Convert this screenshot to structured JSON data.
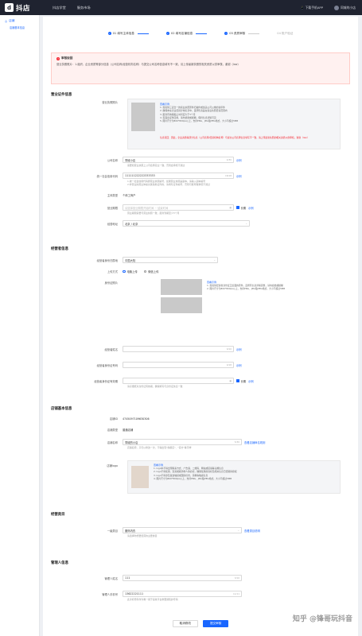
{
  "topbar": {
    "app_name": "抖店",
    "logo_glyph": "d",
    "nav": [
      "抖店学堂",
      "服务市场"
    ],
    "download": "下载手机APP",
    "user": "同城的小店"
  },
  "sidebar": {
    "section": "店铺",
    "item": "店铺基本信息"
  },
  "steps": [
    {
      "label": "01 填写主体信息",
      "state": "done"
    },
    {
      "label": "02 填写店铺信息",
      "state": "done"
    },
    {
      "label": "03 资质审核",
      "state": "current"
    },
    {
      "label": "04 账户验证",
      "state": "todo"
    }
  ],
  "alert": {
    "title": "审核驳回",
    "body": "营业执照照片：1.组织、企业资质等部分信息（公司名称/经营机构名称）与提交公司名称信息填写不一致，请上传最新执照的相关资质以供审核，谢谢（law）"
  },
  "license": {
    "title": "营业证件信息",
    "photo_label": "营业执照照片",
    "tips_title": "查看示例",
    "tips": [
      "1. 需提供三证合一的营业执照原件扫描件或加盖公司公章的复印件",
      "2. 确保未在企业经营异常名录中，且所售商品在营业执照经营范围内",
      "3. 距离有效期截止时间应大于3个月",
      "4. 需露出证件四角，请勿遮挡或模糊，保持信息清晰可见",
      "5. 图片尺寸为800*800px以上，支持PNG、JPG和JPEG格式，大小不超过5MB"
    ],
    "warning": "信息驳回：因此，企业资质等部分信息（公司名称/经营机构名称）与提交公司名称信息填写不一致，请上传最新执照的相关资质以供审核，谢谢（law）",
    "company_label": "公司名称",
    "company_value": "同城小店",
    "company_counter": "4/30",
    "company_link": "示例",
    "company_hint": "需要和营业执照上公司名称完全一致，否则会审核不通过",
    "credit_label": "统一社会信用代码",
    "credit_value": "111111222222333333",
    "credit_counter": "18/18",
    "credit_link": "示例",
    "credit_hint": "1.统一社会信用代码即营业执照编号，如果营业执照是副本，请输入副本编号\n2.非营业执照主体提交其他类证件的，请填写证件编号，否则可能导致审核不通过",
    "entity_label": "主体类型",
    "entity_value": "个体工商户",
    "period_label": "营业期限",
    "period_placeholder": "请选择营业期限开始时间 ~ 结束时间",
    "period_check": "长期",
    "period_link": "示例",
    "period_hint": "营业期限需要与营业执照一致，距离到期至少3个月",
    "address_label": "经营地址",
    "address_value": "北京 / 北京"
  },
  "operator": {
    "title": "经营者信息",
    "region_label": "经营者身份归属地",
    "region_value": "中国大陆",
    "upload_label": "上传方式",
    "upload_options": [
      "电脑上传",
      "微信上传"
    ],
    "id_label": "身份证照片",
    "tips_title": "查看示例",
    "tips": [
      "1. 需提供经营者身份证正反面的原件，且所有信息清晰完整，请勿遮挡或模糊",
      "2. 图片尺寸为800*800px以上，支持PNG、JPG和JPEG格式，大小不超过5MB"
    ],
    "name_label": "经营者姓名",
    "name_counter": "0/10",
    "name_link": "示例",
    "idno_label": "经营者身份证号码",
    "idno_counter": "0/18",
    "idno_link": "示例",
    "validity_label": "经营者身份证有效期",
    "validity_check": "长期",
    "validity_link": "示例",
    "validity_hint": "请仔细核对身份证有效期，确保填写与身份证信息一致"
  },
  "store": {
    "title": "店铺基本信息",
    "id_label": "店铺ID",
    "id_value": "4745097109630306",
    "type_label": "店铺类型",
    "type_value": "普通店铺",
    "name_label": "店铺名称",
    "name_value": "同城的小店",
    "name_counter": "5/30",
    "name_link": "查看店铺命名规则",
    "name_hint": "店铺名称，只可以修改一次，不得出现\"旗舰店\"、\"官方\"等字样",
    "logo_label": "店铺logo",
    "tips_title": "查看示例",
    "tips": [
      "1. logo中不得出现联系方式、广告语、二维码、网站或店铺等违规信息",
      "2. logo不得使用、混淆或模仿他人的商标，确保使用的商标及相关信息已经取得授权",
      "3. logo不得涉及政治敏感或国家标志，宗教等敏感信息",
      "4. 图片尺寸为800*800px以上，支持PNG、JPG和JPEG格式，大小不超过5MB"
    ]
  },
  "category": {
    "title": "经营类目",
    "label": "一级类目",
    "value": "服饰内衣",
    "link": "查看类目说明",
    "hint": "请选择你想要经营的主要类目"
  },
  "admin": {
    "title": "管理人信息",
    "name_label": "管理人姓名",
    "name_value": "111",
    "name_counter": "3/10",
    "phone_label": "管理人手机号",
    "phone_value": "13622221111",
    "phone_counter": "11/11",
    "phone_hint": "此手机号码作为唯一用于接收平台重要通知的号码"
  },
  "footer": {
    "cancel": "取消修改",
    "submit": "提交审核"
  },
  "watermark": "知乎 @锋哥玩抖音"
}
